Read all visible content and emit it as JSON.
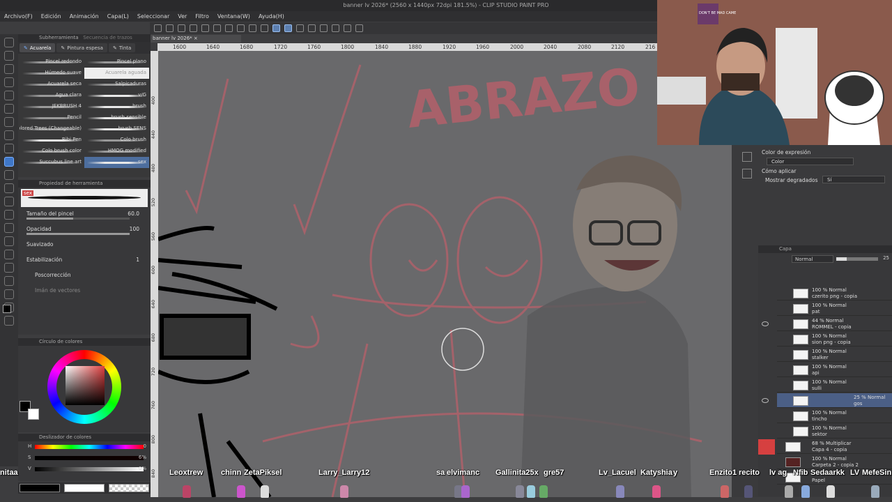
{
  "window": {
    "title": "banner lv 2026* (2560 x 1440px 72dpi 181.5%) - CLIP STUDIO PAINT PRO"
  },
  "menu": [
    "Archivo(F)",
    "Edición",
    "Animación",
    "Capa(L)",
    "Seleccionar",
    "Ver",
    "Filtro",
    "Ventana(W)",
    "Ayuda(H)"
  ],
  "document_tab": "banner lv 2026*",
  "subtool": {
    "header": "Subherramienta",
    "header2": "Secuencia de trazos",
    "tabs": [
      "Acuarela",
      "Pintura espesa",
      "Tinta"
    ],
    "brushes": [
      {
        "label": "Pincel redondo"
      },
      {
        "label": "Pincel plano"
      },
      {
        "label": "Húmedo suave"
      },
      {
        "label": "Acuarela aguada"
      },
      {
        "label": "Acuarela seca"
      },
      {
        "label": "Salpicaduras"
      },
      {
        "label": "Agua clara"
      },
      {
        "label": "v/G"
      },
      {
        "label": "JEKBRUSH 4"
      },
      {
        "label": "brush"
      },
      {
        "label": "Pencil"
      },
      {
        "label": "brush sensible"
      },
      {
        "label": "Colored Trees (Changeable)"
      },
      {
        "label": "brush SENS"
      },
      {
        "label": "Bibi Pen"
      },
      {
        "label": "Colo brush"
      },
      {
        "label": "Colo brush color"
      },
      {
        "label": "HMOG modified"
      },
      {
        "label": "Succubus line art"
      },
      {
        "label": "sex"
      }
    ]
  },
  "tool_property": {
    "header": "Propiedad de herramienta",
    "brush_name": "sex",
    "size_label": "Tamaño del pincel",
    "size_value": "60.0",
    "opacity_label": "Opacidad",
    "opacity_value": "100",
    "smoothing_label": "Suavizado",
    "stabilization_label": "Estabilización",
    "stabilization_value": "1",
    "post_correction_label": "Poscorrección",
    "vector_magnet_label": "Imán de vectores"
  },
  "color_circle": {
    "header": "Círculo de colores",
    "main_color": "#000000",
    "sub_color": "#ffffff"
  },
  "color_sliders": {
    "header": "Deslizador de colores",
    "rows": [
      {
        "key": "H",
        "value": "0"
      },
      {
        "key": "S",
        "value": "6%"
      },
      {
        "key": "V",
        "value": "0%"
      }
    ]
  },
  "ruler": {
    "ticks": [
      "1600",
      "1640",
      "1680",
      "1720",
      "1760",
      "1800",
      "1840",
      "1880",
      "1920",
      "1960",
      "2000",
      "2040",
      "2080",
      "2120",
      "216"
    ]
  },
  "vruler": {
    "ticks": [
      "400",
      "440",
      "480",
      "520",
      "560",
      "600",
      "640",
      "680",
      "720",
      "760",
      "800",
      "840"
    ]
  },
  "canvas": {
    "sketch_text": "ABRAZO"
  },
  "expression": {
    "title": "Color de expresión",
    "value": "Color",
    "apply_label": "Cómo aplicar",
    "gradients_label": "Mostrar degradados",
    "gradients_value": "Sí"
  },
  "layers": {
    "header": "Capa",
    "blend_mode": "Normal",
    "opacity": "25",
    "items": [
      {
        "line1": "100 % Normal",
        "line2": "czerito png - copia"
      },
      {
        "line1": "100 % Normal",
        "line2": "pat"
      },
      {
        "line1": "44 % Normal",
        "line2": "ROMMEL - copia"
      },
      {
        "line1": "100 % Normal",
        "line2": "sion png - copia"
      },
      {
        "line1": "100 % Normal",
        "line2": "stalker"
      },
      {
        "line1": "100 % Normal",
        "line2": "api"
      },
      {
        "line1": "100 % Normal",
        "line2": "sulli"
      },
      {
        "line1": "25 % Normal",
        "line2": "gos"
      },
      {
        "line1": "100 % Normal",
        "line2": "tincho"
      },
      {
        "line1": "100 % Normal",
        "line2": "sektor"
      },
      {
        "line1": "68 % Multiplicar",
        "line2": "Capa 4 - copia"
      },
      {
        "line1": "100 % Normal",
        "line2": "Carpeta 2 - copia 2"
      },
      {
        "line1": "",
        "line2": "Papel"
      }
    ]
  },
  "chat_names": [
    "nitaa",
    "Leoxtrew",
    "chinn",
    "ZetaPiksel",
    "Larry_Larry12",
    "sa",
    "elvimanc",
    "Gallinita25x",
    "gre57",
    "Lv_Lacuel",
    "Katyshia",
    "y",
    "Enzito1",
    "recito",
    "lv ag",
    "Nfib",
    "Sedaarkk",
    "LV",
    "MefeSin"
  ],
  "webcam": {
    "poster_text": "DON'T BE MAD CAME"
  }
}
